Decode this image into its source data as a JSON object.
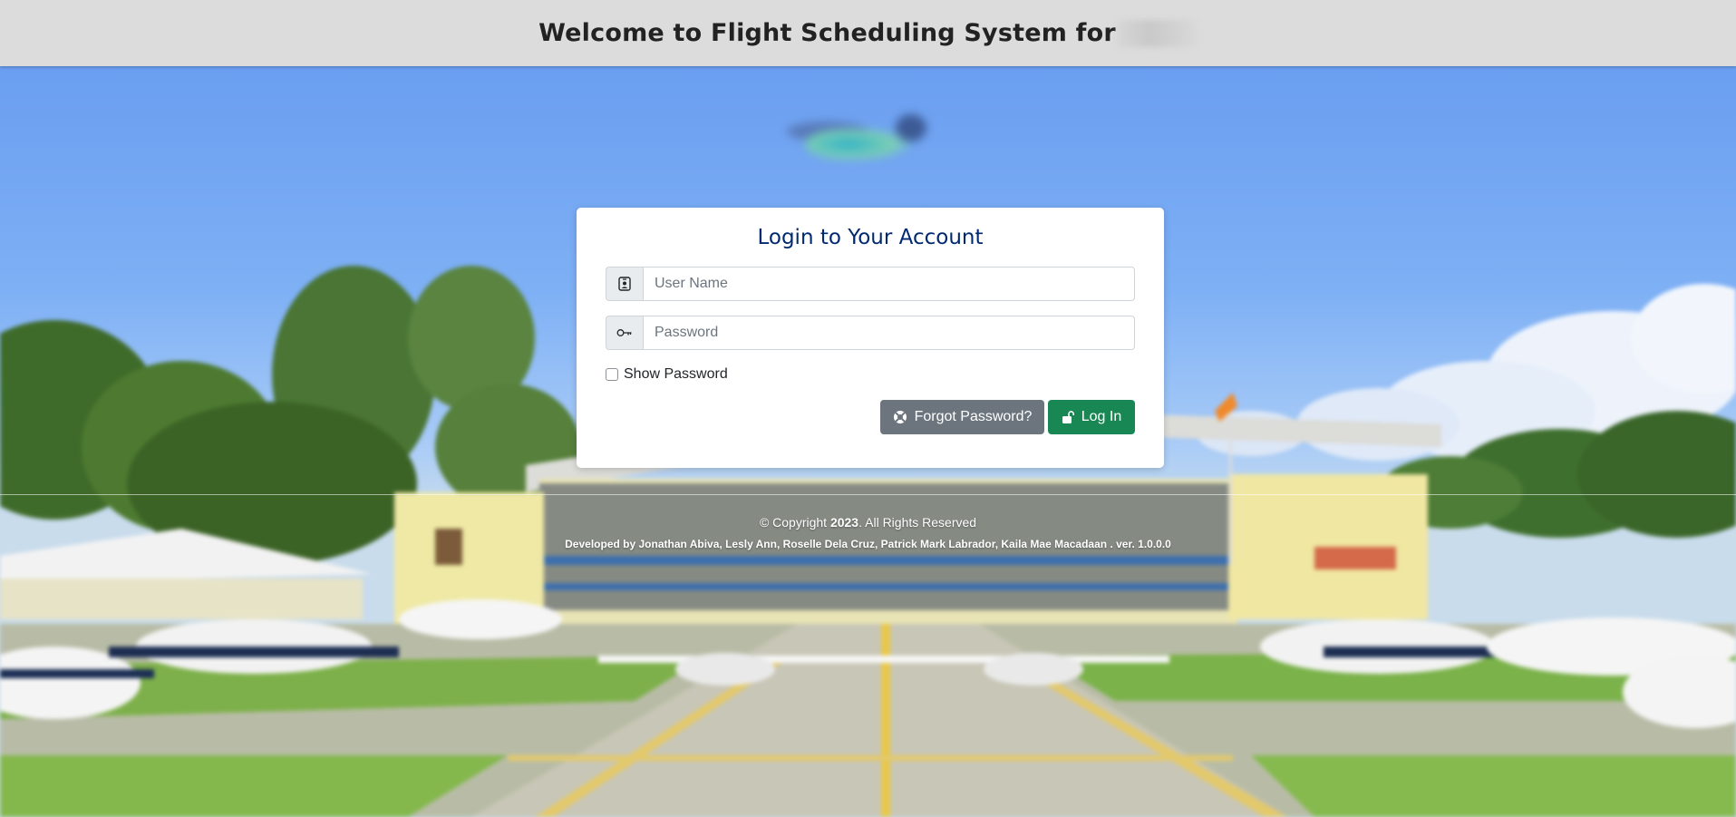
{
  "header": {
    "title": "Welcome to Flight Scheduling System for"
  },
  "login": {
    "title": "Login to Your Account",
    "username_placeholder": "User Name",
    "username_icon": "person-badge-icon",
    "password_placeholder": "Password",
    "password_icon": "key-icon",
    "show_password_label": "Show Password",
    "forgot_button": "Forgot Password?",
    "forgot_icon": "life-preserver-icon",
    "login_button": "Log In",
    "login_icon": "unlock-icon"
  },
  "footer": {
    "copyright_prefix": "© Copyright",
    "copyright_year": "2023",
    "copyright_suffix": ". All Rights Reserved",
    "developed": "Developed by Jonathan Abiva, Lesly Ann, Roselle Dela Cruz, Patrick Mark Labrador, Kaila Mae Macadaan . ver. 1.0.0.0"
  },
  "colors": {
    "title": "#012970",
    "forgot_button": "#6c757d",
    "login_button": "#198754",
    "header_bg": "#dcdcdc"
  }
}
